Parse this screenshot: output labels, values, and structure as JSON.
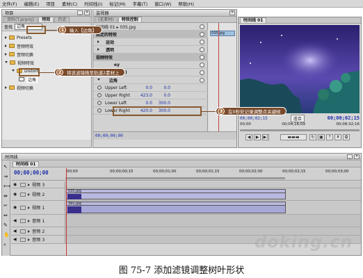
{
  "menu": [
    "文件(F)",
    "编辑(E)",
    "项目",
    "素材(C)",
    "时间线(I)",
    "标记(M)",
    "字幕(T)",
    "窗口(W)",
    "帮助(H)"
  ],
  "project": {
    "title": "项目",
    "tabs": [
      "资料(T.prproj)",
      "特效",
      "历史"
    ],
    "search_label": "查找",
    "search_value": "边角",
    "tree": [
      {
        "label": "Presets",
        "indent": 0,
        "expanded": false
      },
      {
        "label": "音频特效",
        "indent": 0,
        "expanded": false
      },
      {
        "label": "音频切换",
        "indent": 0,
        "expanded": false
      },
      {
        "label": "视频特效",
        "indent": 0,
        "expanded": true
      },
      {
        "label": "Distort",
        "indent": 1,
        "expanded": true
      },
      {
        "label": "边角",
        "indent": 2,
        "expanded": false,
        "selected": true
      },
      {
        "label": "视频切换",
        "indent": 0,
        "expanded": false
      }
    ]
  },
  "effects": {
    "panel_title": "监视器",
    "tabs": [
      "(无素材)",
      "特效控制"
    ],
    "clip_header": "时间线 01 ▸ 035.jpg",
    "clip_name": "035.jpg",
    "fixed_effects_label": "固定的特效",
    "motion_label": "运动",
    "opacity_label": "透明",
    "video_effects_label": "视频特效",
    "effect_row_a": "ey",
    "effect_row_b": "(HLS)",
    "corner_label": "边角",
    "params": [
      {
        "name": "Upper Left",
        "x": "0.0",
        "y": "0.0"
      },
      {
        "name": "Upper Right",
        "x": "423.0",
        "y": "0.0"
      },
      {
        "name": "Lower Left",
        "x": "0.0",
        "y": "300.0"
      },
      {
        "name": "Lower Right",
        "x": "420.0",
        "y": "300.0"
      }
    ],
    "timecode": "00;00;00;00"
  },
  "monitor": {
    "tab": "时间线 01",
    "fit_label": "适合",
    "timecode": "00;00;02;15",
    "ruler_start": "00;00",
    "ruler_mid": "00;04;16;09",
    "ruler_end": "00;08;32;16",
    "bottom_timecode": "00;00;02;15",
    "image_colors": {
      "sky": "#3b2f8c",
      "rock": "#1f5a5a"
    }
  },
  "timeline": {
    "title": "时间线",
    "tab": "时间线 01",
    "timecode": "00;00;00;00",
    "ruler": [
      "00;00",
      "00;00;00;15",
      "00;00;01;00",
      "00;00;01;15",
      "00;00;02;00",
      "00;00;02;15",
      "00;00;03;00"
    ],
    "tracks": [
      {
        "label": "视频 3",
        "kind": "video"
      },
      {
        "label": "视频 2",
        "kind": "video",
        "clip": "035.jpg"
      },
      {
        "label": "视频 1",
        "kind": "video",
        "clip": "391.jpg"
      },
      {
        "label": "音频 1",
        "kind": "audio"
      },
      {
        "label": "音频 2",
        "kind": "audio"
      },
      {
        "label": "音频 3",
        "kind": "audio"
      }
    ]
  },
  "callouts": [
    {
      "num": "1",
      "text": "输入【边角】"
    },
    {
      "num": "2",
      "text": "将该滤镜拖至轨道2素材上"
    },
    {
      "num": "3",
      "text": "在0秒处记录调整点关键帧"
    }
  ],
  "caption": "图 75-7    添加滤镜调整树叶形状",
  "watermark": "doking.cn"
}
